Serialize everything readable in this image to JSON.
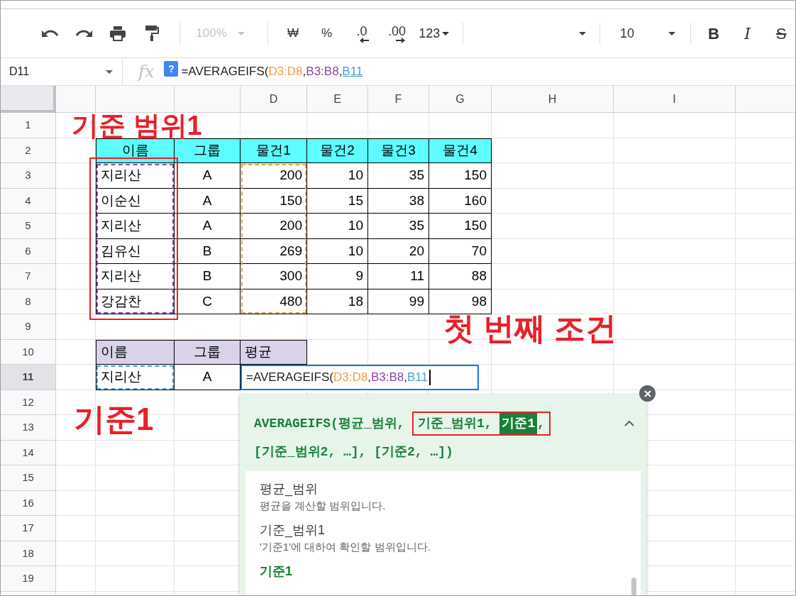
{
  "toolbar": {
    "items": [
      {
        "kind": "undo"
      },
      {
        "kind": "redo"
      },
      {
        "kind": "print"
      },
      {
        "kind": "paint-format"
      },
      {
        "kind": "separator"
      },
      {
        "kind": "zoom",
        "text": "100%",
        "disabled": true
      },
      {
        "kind": "separator"
      },
      {
        "kind": "text",
        "text": "₩"
      },
      {
        "kind": "text",
        "text": "%"
      },
      {
        "kind": "decimal-decrease",
        "text": ".0"
      },
      {
        "kind": "decimal-increase",
        "text": ".00"
      },
      {
        "kind": "format-menu",
        "text": "123"
      },
      {
        "kind": "separator"
      },
      {
        "kind": "font"
      },
      {
        "kind": "separator"
      },
      {
        "kind": "font-size",
        "text": "10"
      },
      {
        "kind": "separator"
      },
      {
        "kind": "bold",
        "text": "B"
      },
      {
        "kind": "italic",
        "text": "I"
      },
      {
        "kind": "strike",
        "text": "S"
      }
    ]
  },
  "formula_bar": {
    "name_box": "D11",
    "fx": "fx",
    "help": "?",
    "segments": [
      {
        "text": "=AVERAGEIFS("
      },
      {
        "text": "D3:D8",
        "color": "#f0a041"
      },
      {
        "text": ","
      },
      {
        "text": "B3:B8",
        "color": "#8e44ad"
      },
      {
        "text": ","
      },
      {
        "text": "B11",
        "color": "#4a9fd8",
        "active": true
      }
    ]
  },
  "column_headers": [
    "D",
    "E",
    "F",
    "G",
    "H",
    "I"
  ],
  "row_headers": [
    {
      "label": "1",
      "selected": false
    },
    {
      "label": "2",
      "selected": false
    },
    {
      "label": "3",
      "selected": false
    },
    {
      "label": "4",
      "selected": false
    },
    {
      "label": "5",
      "selected": false
    },
    {
      "label": "6",
      "selected": false
    },
    {
      "label": "7",
      "selected": false
    },
    {
      "label": "8",
      "selected": false
    },
    {
      "label": "9",
      "selected": false
    },
    {
      "label": "10",
      "selected": false
    },
    {
      "label": "11",
      "selected": true
    },
    {
      "label": "12",
      "selected": false
    },
    {
      "label": "13",
      "selected": false
    },
    {
      "label": "14",
      "selected": false
    },
    {
      "label": "15",
      "selected": false
    },
    {
      "label": "16",
      "selected": false
    },
    {
      "label": "17",
      "selected": false
    },
    {
      "label": "18",
      "selected": false
    },
    {
      "label": "19",
      "selected": false
    }
  ],
  "tables": [
    {
      "kind": "data",
      "color": "#5cfcff",
      "columns": [
        {
          "label": "이름",
          "kind": "name"
        },
        {
          "label": "그룹",
          "kind": "group"
        },
        {
          "label": "물건1",
          "kind": "number"
        },
        {
          "label": "물건2",
          "kind": "number"
        },
        {
          "label": "물건3",
          "kind": "number"
        },
        {
          "label": "물건4",
          "kind": "number"
        }
      ],
      "rows": [
        [
          "지리산",
          "A",
          "200",
          "10",
          "35",
          "150"
        ],
        [
          "이순신",
          "A",
          "150",
          "15",
          "38",
          "160"
        ],
        [
          "지리산",
          "A",
          "200",
          "10",
          "35",
          "150"
        ],
        [
          "김유신",
          "B",
          "269",
          "10",
          "20",
          "70"
        ],
        [
          "지리산",
          "B",
          "300",
          "9",
          "11",
          "88"
        ],
        [
          "강감찬",
          "C",
          "480",
          "18",
          "99",
          "98"
        ]
      ]
    },
    {
      "kind": "query",
      "color": "#d9d2e9",
      "columns": [
        {
          "label": "이름",
          "kind": "name"
        },
        {
          "label": "그룹",
          "kind": "group"
        },
        {
          "label": "평균",
          "kind": "formula"
        }
      ],
      "rows": [
        [
          "지리산",
          "A"
        ]
      ]
    }
  ],
  "editing_cell": {
    "segments": [
      {
        "text": "=AVERAGEIFS("
      },
      {
        "text": "D3:D8",
        "color": "#f0a041"
      },
      {
        "text": ","
      },
      {
        "text": "B3:B8",
        "color": "#8e44ad"
      },
      {
        "text": ","
      },
      {
        "text": "B11",
        "color": "#4a9fd8"
      }
    ]
  },
  "range_highlights": [
    {
      "color": "#8e44ad"
    },
    {
      "color": "#f0a041"
    },
    {
      "color": "#4a9fd8"
    }
  ],
  "annotations": [
    {
      "kind": "label",
      "text": "기준 범위1"
    },
    {
      "kind": "label",
      "text": "첫 번째 조건"
    },
    {
      "kind": "label",
      "text": "기준1"
    },
    {
      "kind": "box"
    }
  ],
  "formula_help": {
    "expanded": true,
    "signature": [
      [
        {
          "text": "AVERAGEIFS(평균_범위, "
        },
        {
          "text": "기준_범위1, ",
          "annotated": true
        },
        {
          "text": "기준1",
          "current": true,
          "annotated": true
        },
        {
          "text": ",",
          "annotated": true
        }
      ],
      [
        {
          "text": "[기준_범위2, …], [기준2, …])"
        }
      ]
    ],
    "arguments": [
      {
        "name": "평균_범위",
        "description": "평균을 계산할 범위입니다.",
        "selected": false
      },
      {
        "name": "기준_범위1",
        "description": "'기준1'에 대하여 확인할 범위입니다.",
        "selected": false
      },
      {
        "name": "기준1",
        "selected": true
      }
    ]
  }
}
